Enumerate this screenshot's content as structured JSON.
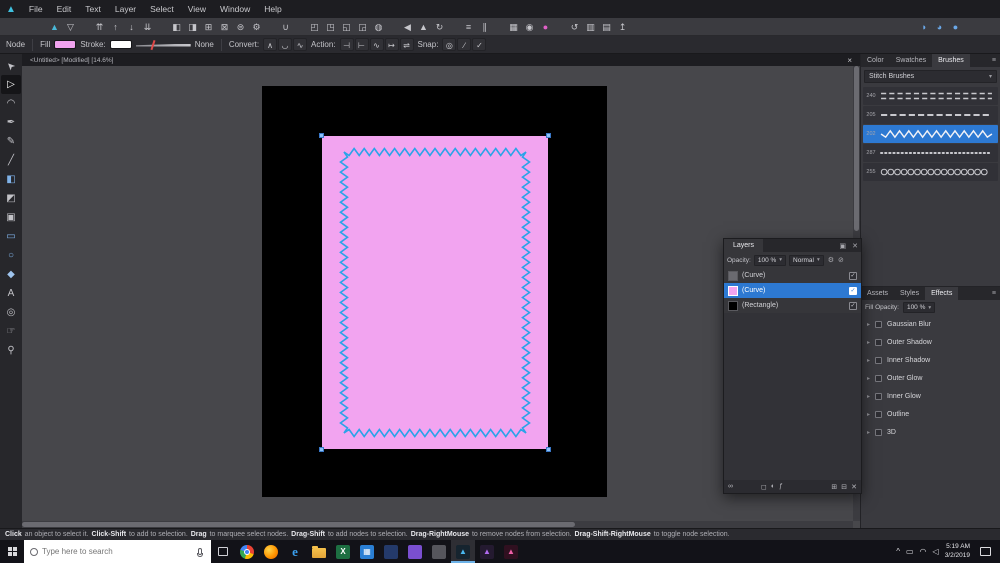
{
  "app": {
    "name": "Affinity Designer",
    "logo_glyph": "▲"
  },
  "menubar": {
    "items": [
      "File",
      "Edit",
      "Text",
      "Layer",
      "Select",
      "View",
      "Window",
      "Help"
    ]
  },
  "toolbar": {
    "groups": [
      {
        "icons": [
          {
            "name": "persona-designer-icon",
            "glyph": "▲",
            "color": "#49b8d8"
          },
          {
            "name": "persona-export-icon",
            "glyph": "▽"
          }
        ]
      },
      {
        "icons": [
          {
            "name": "move-to-front-icon",
            "glyph": "⇈"
          },
          {
            "name": "move-forward-icon",
            "glyph": "↑"
          },
          {
            "name": "move-backward-icon",
            "glyph": "↓"
          },
          {
            "name": "move-to-back-icon",
            "glyph": "⇊"
          }
        ]
      },
      {
        "icons": [
          {
            "name": "insert-behind-icon",
            "glyph": "◧"
          },
          {
            "name": "insert-in-front-icon",
            "glyph": "◨"
          },
          {
            "name": "insert-inside-icon",
            "glyph": "⊞"
          },
          {
            "name": "replace-selection-icon",
            "glyph": "⊠"
          },
          {
            "name": "select-same-icon",
            "glyph": "⊜"
          },
          {
            "name": "assistant-icon",
            "glyph": "⚙"
          }
        ]
      },
      {
        "icons": [
          {
            "name": "snapping-icon",
            "glyph": "∪"
          }
        ]
      },
      {
        "icons": [
          {
            "name": "transform-separately-icon",
            "glyph": "◰"
          },
          {
            "name": "cycle-selection-box-icon",
            "glyph": "◳"
          },
          {
            "name": "show-handles-icon",
            "glyph": "◱"
          },
          {
            "name": "hide-selection-icon",
            "glyph": "◲"
          },
          {
            "name": "preview-mode-icon",
            "glyph": "◍"
          }
        ]
      },
      {
        "icons": [
          {
            "name": "flip-horizontal-icon",
            "glyph": "◀"
          },
          {
            "name": "flip-vertical-icon",
            "glyph": "▲"
          },
          {
            "name": "rotate-ccw-icon",
            "glyph": "↻"
          }
        ]
      },
      {
        "icons": [
          {
            "name": "align-icon",
            "glyph": "≡"
          },
          {
            "name": "distribute-icon",
            "glyph": "∥"
          }
        ]
      },
      {
        "icons": [
          {
            "name": "show-grid-icon",
            "glyph": "▦"
          },
          {
            "name": "snapping-options-icon",
            "glyph": "◉"
          },
          {
            "name": "color-assistant-icon",
            "glyph": "●",
            "color": "#e060c8"
          }
        ]
      },
      {
        "icons": [
          {
            "name": "history-icon",
            "glyph": "↺"
          },
          {
            "name": "resource-manager-icon",
            "glyph": "▥"
          },
          {
            "name": "slice-icon",
            "glyph": "▤"
          },
          {
            "name": "export-icon",
            "glyph": "↥"
          }
        ]
      },
      {
        "align": "right",
        "icons": [
          {
            "name": "view-quality-icon",
            "glyph": "◑",
            "color": "#6aa8e8"
          },
          {
            "name": "color-cycle-icon",
            "glyph": "◕",
            "color": "#6aa8e8"
          },
          {
            "name": "gpu-icon",
            "glyph": "●",
            "color": "#6aa8e8"
          }
        ]
      }
    ]
  },
  "context": {
    "tool_label": "Node",
    "fill_label": "Fill",
    "fill_color": "#f0a2ee",
    "stroke_label": "Stroke:",
    "stroke_color": "#ffffff",
    "stroke_style": "None",
    "convert_label": "Convert:",
    "convert_buttons": [
      {
        "name": "sharp-node-icon",
        "glyph": "∧"
      },
      {
        "name": "smooth-node-icon",
        "glyph": "◡"
      },
      {
        "name": "smart-node-icon",
        "glyph": "∿"
      }
    ],
    "action_label": "Action:",
    "action_buttons": [
      {
        "name": "break-curve-icon",
        "glyph": "⊣"
      },
      {
        "name": "close-curve-icon",
        "glyph": "⊢"
      },
      {
        "name": "smooth-curve-icon",
        "glyph": "∿"
      },
      {
        "name": "join-curves-icon",
        "glyph": "↦"
      },
      {
        "name": "reverse-curves-icon",
        "glyph": "⇌"
      }
    ],
    "snap_label": "Snap:",
    "snap_buttons": [
      {
        "name": "snap-to-nodes-icon",
        "glyph": "◎"
      },
      {
        "name": "snap-off-curve-icon",
        "glyph": "∕"
      },
      {
        "name": "construction-snap-icon",
        "glyph": "✓"
      }
    ]
  },
  "tools": {
    "items": [
      {
        "name": "move-tool",
        "glyph": "➤",
        "rotate": -135
      },
      {
        "name": "node-tool",
        "glyph": "▷",
        "active": true
      },
      {
        "name": "corner-tool",
        "glyph": "◠"
      },
      {
        "name": "pen-tool",
        "glyph": "✒"
      },
      {
        "name": "pencil-tool",
        "glyph": "✎"
      },
      {
        "name": "vector-brush-tool",
        "glyph": "╱"
      },
      {
        "name": "fill-tool",
        "glyph": "◧",
        "color": "#7fb2e8"
      },
      {
        "name": "transparency-tool",
        "glyph": "◩"
      },
      {
        "name": "vector-crop-tool",
        "glyph": "▣"
      },
      {
        "name": "rectangle-tool",
        "glyph": "▭",
        "color": "#7fb2e8"
      },
      {
        "name": "ellipse-tool",
        "glyph": "○",
        "color": "#7fb2e8"
      },
      {
        "name": "custom-shape-tool",
        "glyph": "◆",
        "color": "#9fc4ee"
      },
      {
        "name": "text-tool",
        "glyph": "A"
      },
      {
        "name": "color-picker-tool",
        "glyph": "◎"
      },
      {
        "name": "view-tool",
        "glyph": "☞"
      },
      {
        "name": "zoom-tool",
        "glyph": "⚲"
      }
    ]
  },
  "document": {
    "tab_title": "<Untitled> [Modified] [14.6%]",
    "close_glyph": "×"
  },
  "canvas": {
    "page_color": "#000000",
    "rect_color": "#f2a4f0",
    "stitch_color": "#2ba3e8",
    "handle_color": "#8cc2f8"
  },
  "brushes_panel": {
    "tabs": [
      {
        "label": "Color"
      },
      {
        "label": "Swatches"
      },
      {
        "label": "Brushes",
        "active": true
      }
    ],
    "menu_icon": "≡",
    "category": "Stitch Brushes",
    "caret_icon": "▾",
    "brushes": [
      {
        "id": "240",
        "pattern": "dashes-double"
      },
      {
        "id": "205",
        "pattern": "dashes"
      },
      {
        "id": "202",
        "pattern": "zigzag",
        "selected": true
      },
      {
        "id": "287",
        "pattern": "dots"
      },
      {
        "id": "255",
        "pattern": "loops"
      }
    ]
  },
  "layers_panel": {
    "title": "Layers",
    "menu_icon": "▣",
    "close_icon": "✕",
    "opacity_label": "Opacity:",
    "opacity_value": "100 %",
    "blend_mode": "Normal",
    "caret_icon": "▾",
    "gear_icon": "⚙",
    "lock_icon": "⊘",
    "check_icon": "✓",
    "layers": [
      {
        "label": "(Curve)",
        "thumb_color": "#6a6a70",
        "checked": true
      },
      {
        "label": "(Curve)",
        "thumb_color": "#f2a4f0",
        "checked": true,
        "selected": true
      },
      {
        "label": "(Rectangle)",
        "thumb_color": "#000000",
        "checked": true
      }
    ],
    "footer_icons": [
      {
        "name": "link-icon",
        "glyph": "∞"
      },
      {
        "name": "mask-icon",
        "glyph": "◻"
      },
      {
        "name": "adjustment-icon",
        "glyph": "◐"
      },
      {
        "name": "fx-icon",
        "glyph": "ƒ"
      },
      {
        "name": "new-layer-icon",
        "glyph": "⊞"
      },
      {
        "name": "new-group-icon",
        "glyph": "⊟"
      },
      {
        "name": "delete-icon",
        "glyph": "✕"
      }
    ]
  },
  "effects_panel": {
    "tabs": [
      {
        "label": "Assets"
      },
      {
        "label": "Styles"
      },
      {
        "label": "Effects",
        "active": true
      }
    ],
    "menu_icon": "≡",
    "fill_opacity_label": "Fill Opacity:",
    "fill_opacity_value": "100 %",
    "caret_icon": "▾",
    "expand_icon": "▸",
    "effects": [
      "Gaussian Blur",
      "Outer Shadow",
      "Inner Shadow",
      "Outer Glow",
      "Inner Glow",
      "Outline",
      "3D"
    ]
  },
  "status": {
    "segments": [
      {
        "t": "Click",
        "b": true
      },
      {
        "t": " an object to select it. ",
        "b": false
      },
      {
        "t": "Click-Shift",
        "b": true
      },
      {
        "t": " to add to selection. ",
        "b": false
      },
      {
        "t": "Drag",
        "b": true
      },
      {
        "t": " to marquee select nodes. ",
        "b": false
      },
      {
        "t": "Drag-Shift",
        "b": true
      },
      {
        "t": " to add nodes to selection. ",
        "b": false
      },
      {
        "t": "Drag-RightMouse",
        "b": true
      },
      {
        "t": " to remove nodes from selection. ",
        "b": false
      },
      {
        "t": "Drag-Shift-RightMouse",
        "b": true
      },
      {
        "t": " to toggle node selection.",
        "b": false
      }
    ]
  },
  "taskbar": {
    "search_placeholder": "Type here to search",
    "apps": [
      {
        "name": "task-view-icon",
        "kind": "taskview"
      },
      {
        "name": "chrome-icon",
        "kind": "chrome"
      },
      {
        "name": "firefox-icon",
        "kind": "firefox"
      },
      {
        "name": "edge-icon",
        "kind": "edge",
        "glyph": "e"
      },
      {
        "name": "file-explorer-icon",
        "kind": "folder"
      },
      {
        "name": "excel-icon",
        "kind": "excel",
        "glyph": "X"
      },
      {
        "name": "store-icon",
        "kind": "store",
        "glyph": "▦"
      },
      {
        "name": "app-icon-1",
        "kind": "navy"
      },
      {
        "name": "app-icon-2",
        "kind": "purple"
      },
      {
        "name": "app-icon-3",
        "kind": "gray"
      },
      {
        "name": "affinity-designer-icon",
        "kind": "af-designer",
        "glyph": "▲",
        "active": true
      },
      {
        "name": "affinity-photo-icon",
        "kind": "af-photo",
        "glyph": "▲"
      },
      {
        "name": "affinity-publisher-icon",
        "kind": "af-publisher",
        "glyph": "▲"
      }
    ],
    "tray": [
      {
        "name": "hidden-icons-chevron",
        "glyph": "^"
      },
      {
        "name": "battery-icon",
        "glyph": "▭"
      },
      {
        "name": "network-icon",
        "glyph": "◠"
      },
      {
        "name": "volume-icon",
        "glyph": "◁"
      }
    ],
    "clock_time": "5:19 AM",
    "clock_date": "3/2/2019"
  }
}
